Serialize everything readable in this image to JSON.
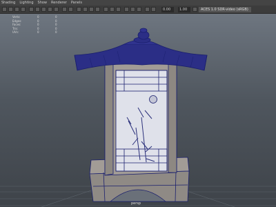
{
  "menu": [
    "Shading",
    "Lighting",
    "Show",
    "Renderer",
    "Panels"
  ],
  "toolbar": {
    "field1": "0.00",
    "field2": "1.00",
    "color_space": "ACES 1.0 SDR-video (sRGB)"
  },
  "hud": [
    {
      "label": "Verts:",
      "v1": "0",
      "v2": "0"
    },
    {
      "label": "Edges:",
      "v1": "0",
      "v2": "0"
    },
    {
      "label": "Faces:",
      "v1": "0",
      "v2": "0"
    },
    {
      "label": "Tris:",
      "v1": "0",
      "v2": "0"
    },
    {
      "label": "UVs:",
      "v1": "0",
      "v2": "0"
    }
  ],
  "camera_label": "persp",
  "colors": {
    "wire": "#1a1f6e",
    "wood": "#a29c96",
    "paper": "#dfe1ea",
    "ink": "#2a2f7a",
    "grid": "#5d646c"
  }
}
